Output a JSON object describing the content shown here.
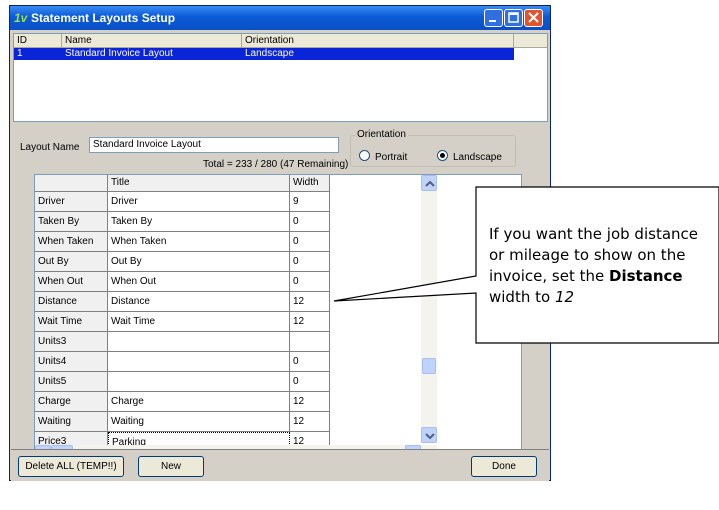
{
  "window": {
    "title": "Statement Layouts Setup",
    "app_icon_glyph": "1v"
  },
  "list": {
    "columns": [
      "ID",
      "Name",
      "Orientation"
    ],
    "rows": [
      {
        "id": "1",
        "name": "Standard Invoice Layout",
        "orientation": "Landscape"
      }
    ]
  },
  "form": {
    "layout_name_label": "Layout Name",
    "layout_name_value": "Standard Invoice Layout",
    "total_text": "Total = 233 / 280 (47 Remaining)",
    "orientation_label": "Orientation",
    "orientation_options": [
      "Portrait",
      "Landscape"
    ],
    "orientation_selected": "Landscape"
  },
  "grid": {
    "columns": [
      "",
      "Title",
      "Width"
    ],
    "rows": [
      {
        "field": "Driver",
        "title": "Driver",
        "width": "9"
      },
      {
        "field": "Taken By",
        "title": "Taken By",
        "width": "0"
      },
      {
        "field": "When Taken",
        "title": "When Taken",
        "width": "0"
      },
      {
        "field": "Out By",
        "title": "Out By",
        "width": "0"
      },
      {
        "field": "When Out",
        "title": "When Out",
        "width": "0"
      },
      {
        "field": "Distance",
        "title": "Distance",
        "width": "12"
      },
      {
        "field": "Wait Time",
        "title": "Wait Time",
        "width": "12"
      },
      {
        "field": "Units3",
        "title": "",
        "width": ""
      },
      {
        "field": "Units4",
        "title": "",
        "width": "0"
      },
      {
        "field": "Units5",
        "title": "",
        "width": "0"
      },
      {
        "field": "Charge",
        "title": "Charge",
        "width": "12"
      },
      {
        "field": "Waiting",
        "title": "Waiting",
        "width": "12"
      },
      {
        "field": "Price3",
        "title": "Parking",
        "width": "12"
      }
    ]
  },
  "buttons": {
    "delete_all": "Delete ALL (TEMP!!)",
    "new": "New",
    "done": "Done"
  },
  "callout": {
    "text_before": "If you want the job distance or mileage to show on the invoice, set the ",
    "bold_word": "Distance",
    "text_middle": " width to ",
    "italic_value": "12"
  },
  "colors": {
    "titlebar": "#0a5ad8",
    "selection": "#0a24d8",
    "dialog_face": "#d4d0c8"
  }
}
